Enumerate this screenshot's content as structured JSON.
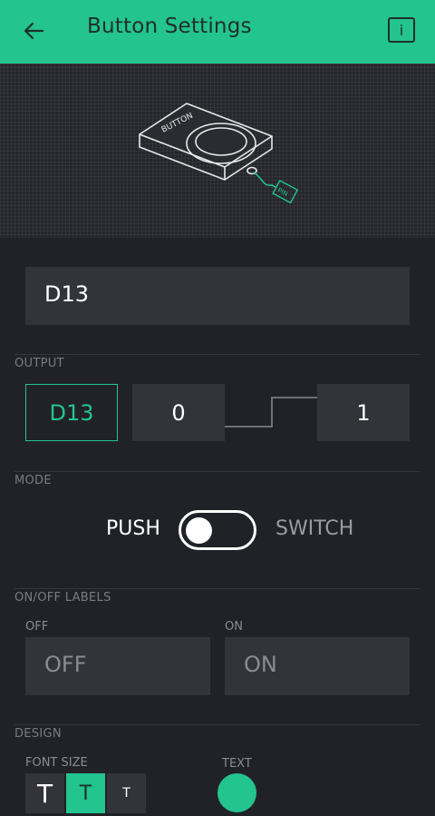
{
  "header": {
    "title": "Button Settings",
    "info_label": "i"
  },
  "widget_name": "D13",
  "output": {
    "label": "OUTPUT",
    "pin": "D13",
    "low_value": "0",
    "high_value": "1"
  },
  "mode": {
    "label": "MODE",
    "push": "PUSH",
    "switch": "SWITCH",
    "selected": "PUSH"
  },
  "labels_section": {
    "label": "ON/OFF LABELS",
    "off_label": "OFF",
    "on_label": "ON",
    "off_placeholder": "OFF",
    "on_placeholder": "ON"
  },
  "design": {
    "label": "DESIGN",
    "font_size_label": "FONT SIZE",
    "font_sizes": [
      "T",
      "T",
      "T"
    ],
    "selected_font_size": 1,
    "text_label": "TEXT",
    "text_color": "#23c48e"
  },
  "illustration": {
    "button_text": "BUTTON",
    "pin_text": "PIN"
  },
  "colors": {
    "accent": "#23c48e",
    "background": "#212227",
    "field": "#33343a"
  }
}
